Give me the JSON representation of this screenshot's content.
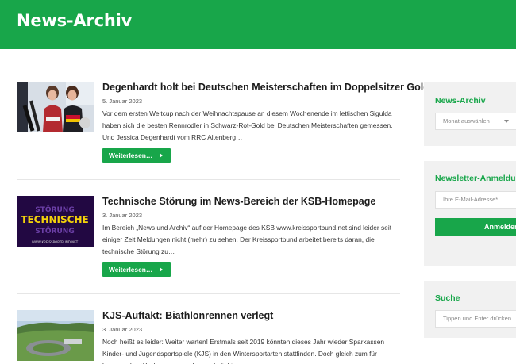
{
  "header": {
    "title": "News-Archiv"
  },
  "articles": [
    {
      "title": "Degenhardt holt bei Deutschen Meisterschaften im Doppelsitzer Gold",
      "date": "5. Januar 2023",
      "excerpt": "Vor dem ersten Weltcup nach der Weihnachtspause an diesem Wochenende im lettischen Sigulda haben sich die besten Rennrodler in Schwarz-Rot-Gold bei Deutschen Meisterschaften gemessen. Und Jessica Degenhardt vom RRC Altenberg…",
      "more_label": "Weiterlesen…"
    },
    {
      "title": "Technische Störung im News-Bereich der KSB-Homepage",
      "date": "3. Januar 2023",
      "excerpt": "Im Bereich „News und Archiv“ auf der Homepage des KSB www.kreissportbund.net sind leider seit einiger Zeit Meldungen nicht (mehr) zu sehen. Der Kreissportbund arbeitet bereits daran, die technische Störung zu…",
      "more_label": "Weiterlesen…",
      "thumb_text": {
        "line1": "STÖRUNG",
        "line2": "TECHNISCHE",
        "line3": "STÖRUNG",
        "footer": "WWW.KREISSPORTBUND.NET"
      }
    },
    {
      "title": "KJS-Auftakt: Biathlonrennen verlegt",
      "date": "3. Januar 2023",
      "excerpt": "Noch heißt es leider: Weiter warten! Erstmals seit 2019 könnten dieses Jahr wieder Sparkassen Kinder- und Jugendsportspiele (KJS) in den Wintersportarten stattfinden. Doch gleich zum für kommendes Wochenende geplanten Auftakt…"
    }
  ],
  "sidebar": {
    "archive": {
      "title": "News-Archiv",
      "select_value": "Monat auswählen"
    },
    "newsletter": {
      "title": "Newsletter-Anmeldung",
      "email_placeholder": "Ihre E-Mail-Adresse*",
      "submit_label": "Anmelden"
    },
    "search": {
      "title": "Suche",
      "placeholder": "Tippen und Enter drücken"
    }
  },
  "colors": {
    "accent": "#18a64a",
    "sidebar_bg": "#f1f1f1",
    "text": "#333333"
  },
  "icons": [
    "arrow-right-icon",
    "chevron-down-icon"
  ]
}
